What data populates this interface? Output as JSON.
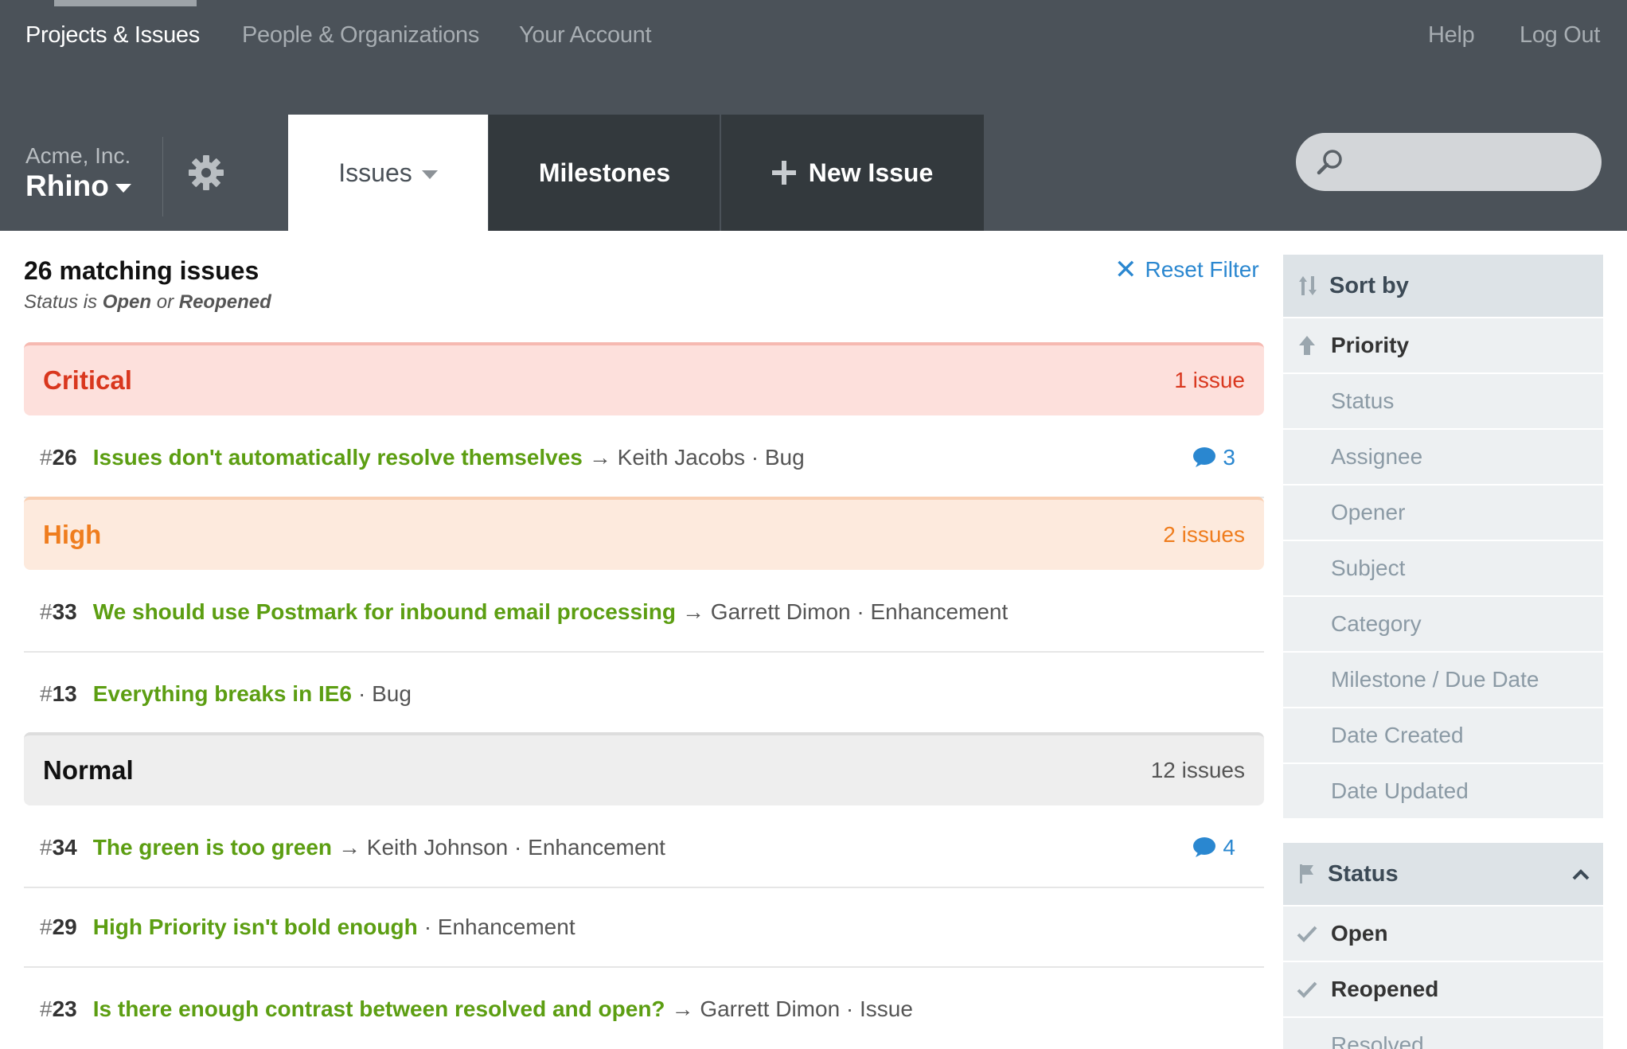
{
  "topnav": {
    "projects": "Projects & Issues",
    "people": "People & Organizations",
    "account": "Your Account",
    "help": "Help",
    "logout": "Log Out"
  },
  "project": {
    "org": "Acme, Inc.",
    "name": "Rhino"
  },
  "tabs": {
    "issues": "Issues",
    "milestones": "Milestones",
    "new_issue": "New Issue"
  },
  "search": {
    "placeholder": ""
  },
  "summary": {
    "title": "26 matching issues",
    "filter_prefix": "Status is",
    "filter_value1": "Open",
    "filter_join": "or",
    "filter_value2": "Reopened",
    "reset": "Reset Filter"
  },
  "groups": [
    {
      "name": "Critical",
      "count": "1 issue",
      "issues": [
        {
          "num": "26",
          "title": "Issues don't automatically resolve themselves",
          "meta": "→ Keith Jacobs · Bug",
          "comments": "3"
        }
      ]
    },
    {
      "name": "High",
      "count": "2 issues",
      "issues": [
        {
          "num": "33",
          "title": "We should use Postmark for inbound email processing",
          "meta": "→ Garrett Dimon · Enhancement",
          "comments": ""
        },
        {
          "num": "13",
          "title": "Everything breaks in IE6",
          "meta": "· Bug",
          "comments": ""
        }
      ]
    },
    {
      "name": "Normal",
      "count": "12 issues",
      "issues": [
        {
          "num": "34",
          "title": "The green is too green",
          "meta": "→ Keith Johnson · Enhancement",
          "comments": "4"
        },
        {
          "num": "29",
          "title": "High Priority isn't bold enough",
          "meta": "· Enhancement",
          "comments": ""
        },
        {
          "num": "23",
          "title": "Is there enough contrast between resolved and open?",
          "meta": "→ Garrett Dimon · Issue",
          "comments": ""
        }
      ]
    }
  ],
  "sort": {
    "header": "Sort by",
    "items": [
      "Priority",
      "Status",
      "Assignee",
      "Opener",
      "Subject",
      "Category",
      "Milestone / Due Date",
      "Date Created",
      "Date Updated"
    ],
    "selected": "Priority"
  },
  "status_filter": {
    "header": "Status",
    "items": [
      "Open",
      "Reopened",
      "Resolved"
    ],
    "checked": [
      "Open",
      "Reopened"
    ]
  },
  "colors": {
    "header_bg": "#4b5259",
    "dark_tab_bg": "#33393d",
    "link_blue": "#2a87d0",
    "issue_green": "#5c9e12",
    "critical": "#d9371e",
    "high": "#ef7d1e"
  }
}
